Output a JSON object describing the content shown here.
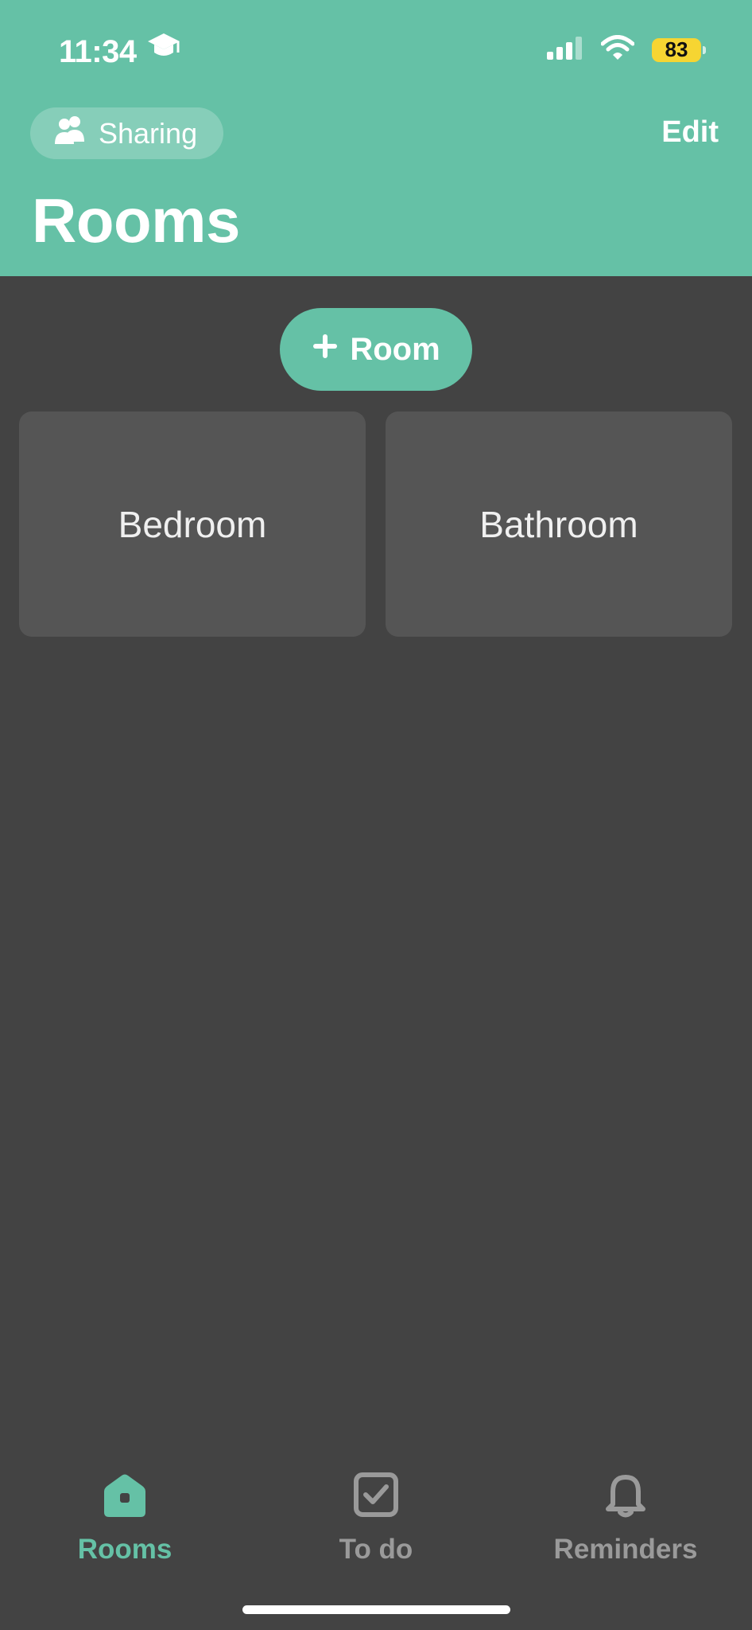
{
  "status_bar": {
    "time": "11:34",
    "battery": "83",
    "icons": [
      "graduation-cap-icon",
      "signal-icon",
      "wifi-icon",
      "battery-icon"
    ]
  },
  "header": {
    "sharing_label": "Sharing",
    "edit_label": "Edit",
    "title": "Rooms"
  },
  "main": {
    "add_room_label": "Room",
    "rooms": [
      {
        "name": "Bedroom"
      },
      {
        "name": "Bathroom"
      }
    ]
  },
  "tabbar": {
    "tabs": [
      {
        "label": "Rooms",
        "icon": "home-icon",
        "active": true
      },
      {
        "label": "To do",
        "icon": "checkbox-icon",
        "active": false
      },
      {
        "label": "Reminders",
        "icon": "bell-icon",
        "active": false
      }
    ]
  },
  "colors": {
    "accent": "#65c1a6",
    "background": "#434343",
    "card": "#555555",
    "tab_inactive": "#9a9a9a",
    "battery": "#f6d532"
  }
}
